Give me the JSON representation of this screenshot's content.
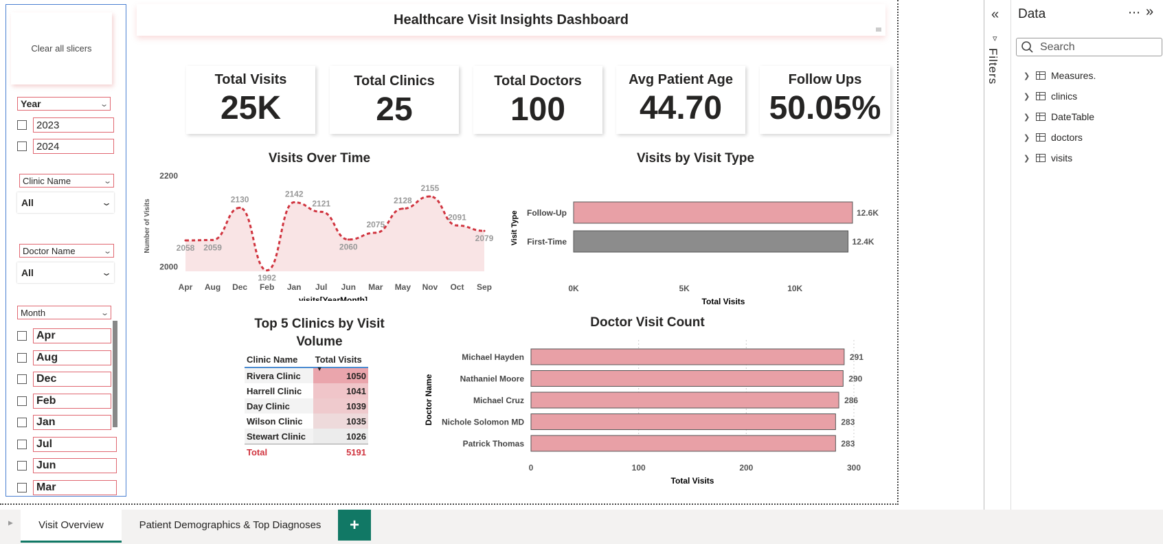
{
  "slicers": {
    "clear_label": "Clear all slicers",
    "year": {
      "header": "Year",
      "options": [
        "2023",
        "2024"
      ]
    },
    "clinic": {
      "header": "Clinic Name",
      "value": "All"
    },
    "doctor": {
      "header": "Doctor Name",
      "value": "All"
    },
    "month": {
      "header": "Month",
      "options": [
        "Apr",
        "Aug",
        "Dec",
        "Feb",
        "Jan",
        "Jul",
        "Jun",
        "Mar"
      ]
    }
  },
  "title": "Healthcare Visit Insights Dashboard",
  "kpis": [
    {
      "label": "Total Visits",
      "value": "25K"
    },
    {
      "label": "Total Clinics",
      "value": "25"
    },
    {
      "label": "Total Doctors",
      "value": "100"
    },
    {
      "label": "Avg Patient Age",
      "value": "44.70"
    },
    {
      "label": "Follow Ups",
      "value": "50.05%"
    }
  ],
  "chart_data": [
    {
      "type": "area",
      "title": "Visits Over Time",
      "xlabel": "visits[YearMonth]",
      "ylabel": "Number of Visits",
      "categories": [
        "Apr",
        "Aug",
        "Dec",
        "Feb",
        "Jan",
        "Jul",
        "Jun",
        "Mar",
        "May",
        "Nov",
        "Oct",
        "Sep"
      ],
      "values": [
        2058,
        2059,
        2130,
        1992,
        2142,
        2121,
        2060,
        2075,
        2128,
        2155,
        2091,
        2079
      ],
      "yticks": [
        "2000",
        "2200"
      ],
      "ylim": [
        1990,
        2220
      ],
      "color": "#d0343f"
    },
    {
      "type": "bar",
      "title": "Visits by Visit Type",
      "xlabel": "Total Visits",
      "ylabel": "Visit Type",
      "categories": [
        "Follow-Up",
        "First-Time"
      ],
      "values": [
        12600,
        12400
      ],
      "data_labels": [
        "12.6K",
        "12.4K"
      ],
      "colors": [
        "#e8a0a6",
        "#8c8c8c"
      ],
      "xticks": [
        "0K",
        "5K",
        "10K"
      ],
      "xlim": [
        0,
        13500
      ]
    },
    {
      "type": "table",
      "title": "Top 5 Clinics by Visit Volume",
      "columns": [
        "Clinic Name",
        "Total Visits"
      ],
      "rows": [
        [
          "Rivera Clinic",
          "1050"
        ],
        [
          "Harrell Clinic",
          "1041"
        ],
        [
          "Day Clinic",
          "1039"
        ],
        [
          "Wilson Clinic",
          "1035"
        ],
        [
          "Stewart Clinic",
          "1026"
        ]
      ],
      "total": [
        "Total",
        "5191"
      ]
    },
    {
      "type": "bar",
      "title": "Doctor Visit Count",
      "xlabel": "Total Visits",
      "ylabel": "Doctor Name",
      "categories": [
        "Michael Hayden",
        "Nathaniel Moore",
        "Michael Cruz",
        "Nichole Solomon MD",
        "Patrick Thomas"
      ],
      "values": [
        291,
        290,
        286,
        283,
        283
      ],
      "xticks": [
        "0",
        "100",
        "200",
        "300"
      ],
      "xlim": [
        0,
        300
      ],
      "color": "#e8a0a6"
    }
  ],
  "filters_label": "Filters",
  "data_pane": {
    "title": "Data",
    "search_placeholder": "Search",
    "items": [
      "Measures.",
      "clinics",
      "DateTable",
      "doctors",
      "visits"
    ]
  },
  "tabs": [
    "Visit Overview",
    "Patient Demographics & Top Diagnoses",
    "+"
  ]
}
